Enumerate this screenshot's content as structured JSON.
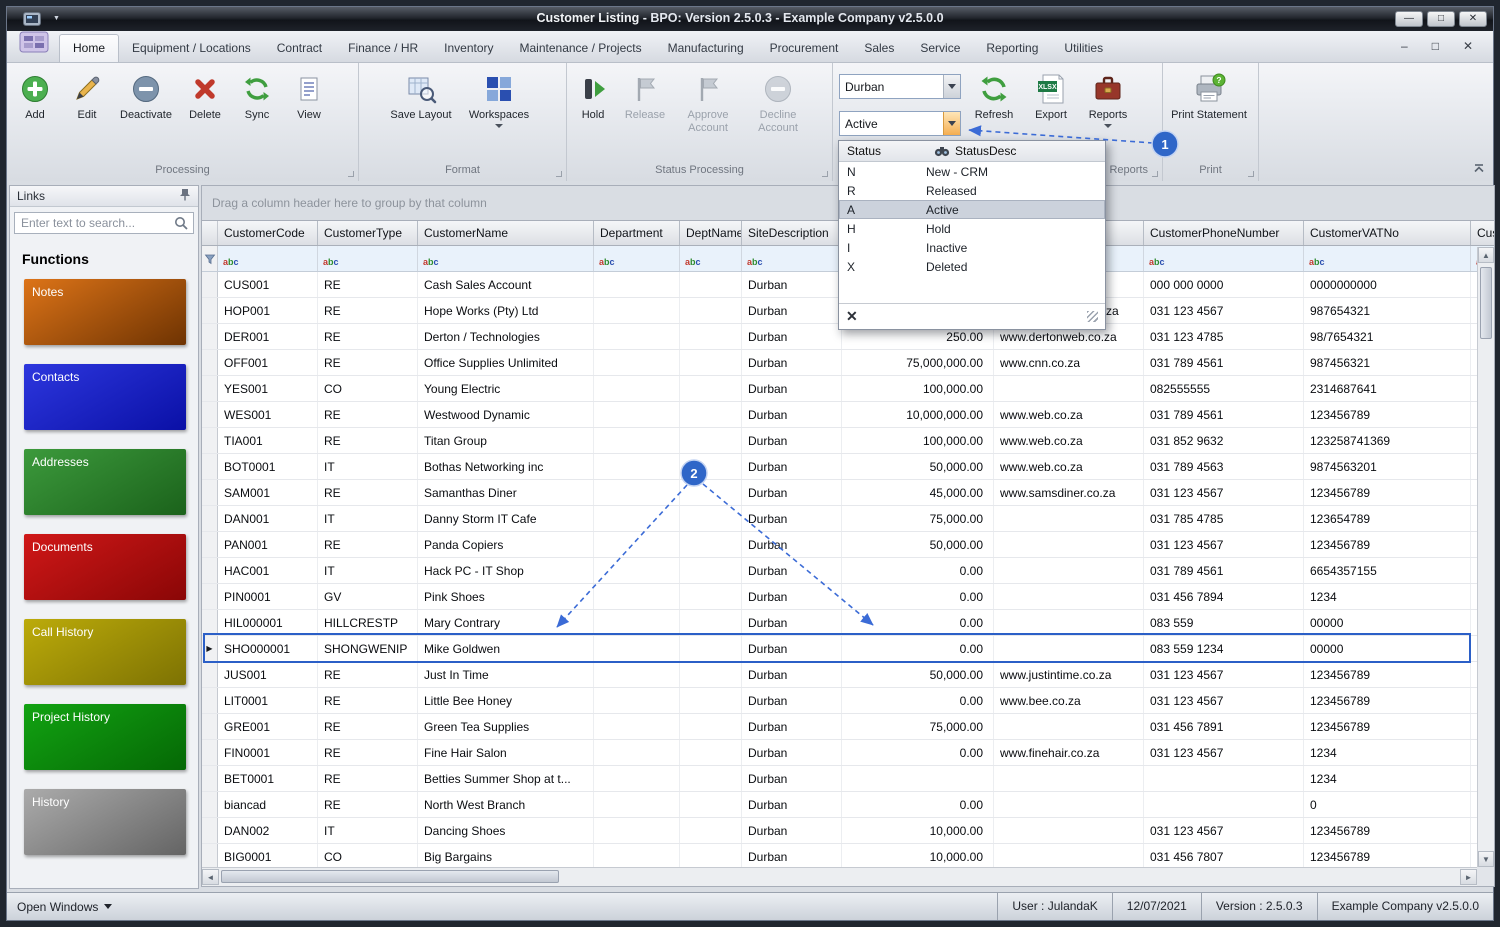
{
  "window": {
    "title_main": "Customer Listing",
    "title_rest": " - BPO: Version 2.5.0.3 - Example Company v2.5.0.0"
  },
  "tabs": [
    "Home",
    "Equipment / Locations",
    "Contract",
    "Finance / HR",
    "Inventory",
    "Maintenance / Projects",
    "Manufacturing",
    "Procurement",
    "Sales",
    "Service",
    "Reporting",
    "Utilities"
  ],
  "active_tab": "Home",
  "ribbon": {
    "groups": {
      "processing": "Processing",
      "format": "Format",
      "status_processing": "Status Processing",
      "reports": "Reports",
      "print": "Print"
    },
    "buttons": {
      "add": "Add",
      "edit": "Edit",
      "deactivate": "Deactivate",
      "delete": "Delete",
      "sync": "Sync",
      "view": "View",
      "save_layout": "Save Layout",
      "workspaces": "Workspaces",
      "hold": "Hold",
      "release": "Release",
      "approve": "Approve Account",
      "decline": "Decline Account",
      "refresh": "Refresh",
      "export": "Export",
      "reports": "Reports",
      "print_statement": "Print Statement"
    },
    "site_combo": "Durban",
    "status_combo": "Active"
  },
  "status_dropdown": {
    "col_status": "Status",
    "col_desc": "StatusDesc",
    "options": [
      {
        "code": "N",
        "desc": "New - CRM"
      },
      {
        "code": "R",
        "desc": "Released"
      },
      {
        "code": "A",
        "desc": "Active",
        "selected": true
      },
      {
        "code": "H",
        "desc": "Hold"
      },
      {
        "code": "I",
        "desc": "Inactive"
      },
      {
        "code": "X",
        "desc": "Deleted"
      }
    ]
  },
  "sidebar": {
    "title": "Links",
    "search_placeholder": "Enter text to search...",
    "section_title": "Functions",
    "tiles": [
      {
        "label": "Notes",
        "c1": "#dd7418",
        "c2": "#6e3302"
      },
      {
        "label": "Contacts",
        "c1": "#2d37de",
        "c2": "#0a10a6"
      },
      {
        "label": "Addresses",
        "c1": "#3c9a3c",
        "c2": "#1b621b"
      },
      {
        "label": "Documents",
        "c1": "#d01818",
        "c2": "#8a0606"
      },
      {
        "label": "Call History",
        "c1": "#bcab0a",
        "c2": "#7d7203"
      },
      {
        "label": "Project History",
        "c1": "#12a312",
        "c2": "#056805"
      },
      {
        "label": "History",
        "c1": "#ababab",
        "c2": "#646464"
      }
    ]
  },
  "grid": {
    "group_hint": "Drag a column header here to group by that column",
    "columns": [
      "CustomerCode",
      "CustomerType",
      "CustomerName",
      "Department",
      "DeptName",
      "SiteDescription",
      "",
      "",
      "CustomerPhoneNumber",
      "CustomerVATNo",
      "Cus"
    ],
    "rows": [
      [
        "CUS001",
        "RE",
        "Cash Sales Account",
        "",
        "",
        "Durban",
        "",
        "",
        "000 000 0000",
        "0000000000",
        ""
      ],
      [
        "HOP001",
        "RE",
        "Hope Works (Pty) Ltd",
        "",
        "",
        "Durban",
        "",
        "www.hopeworks.co.za",
        "031 123 4567",
        "987654321",
        ""
      ],
      [
        "DER001",
        "RE",
        "Derton / Technologies",
        "",
        "",
        "Durban",
        "250.00",
        "www.dertonweb.co.za",
        "031 123 4785",
        "98/7654321",
        ""
      ],
      [
        "OFF001",
        "RE",
        "Office Supplies Unlimited",
        "",
        "",
        "Durban",
        "75,000,000.00",
        "www.cnn.co.za",
        "031 789 4561",
        "987456321",
        ""
      ],
      [
        "YES001",
        "CO",
        "Young Electric",
        "",
        "",
        "Durban",
        "100,000.00",
        "",
        "082555555",
        "2314687641",
        ""
      ],
      [
        "WES001",
        "RE",
        "Westwood Dynamic",
        "",
        "",
        "Durban",
        "10,000,000.00",
        "www.web.co.za",
        "031 789 4561",
        "123456789",
        ""
      ],
      [
        "TIA001",
        "RE",
        "Titan Group",
        "",
        "",
        "Durban",
        "100,000.00",
        "www.web.co.za",
        "031 852 9632",
        "123258741369",
        ""
      ],
      [
        "BOT0001",
        "IT",
        "Bothas Networking inc",
        "",
        "",
        "Durban",
        "50,000.00",
        "www.web.co.za",
        "031 789 4563",
        "9874563201",
        ""
      ],
      [
        "SAM001",
        "RE",
        "Samanthas Diner",
        "",
        "",
        "Durban",
        "45,000.00",
        "www.samsdiner.co.za",
        "031 123 4567",
        "123456789",
        ""
      ],
      [
        "DAN001",
        "IT",
        "Danny Storm IT Cafe",
        "",
        "",
        "Durban",
        "75,000.00",
        "",
        "031 785 4785",
        "123654789",
        ""
      ],
      [
        "PAN001",
        "RE",
        "Panda Copiers",
        "",
        "",
        "Durban",
        "50,000.00",
        "",
        "031 123 4567",
        "123456789",
        ""
      ],
      [
        "HAC001",
        "IT",
        "Hack PC - IT Shop",
        "",
        "",
        "Durban",
        "0.00",
        "",
        "031 789 4561",
        "6654357155",
        ""
      ],
      [
        "PIN0001",
        "GV",
        "Pink Shoes",
        "",
        "",
        "Durban",
        "0.00",
        "",
        "031 456 7894",
        "1234",
        ""
      ],
      [
        "HIL000001",
        "HILLCRESTP",
        "Mary Contrary",
        "",
        "",
        "Durban",
        "0.00",
        "",
        "083 559",
        "00000",
        ""
      ],
      [
        "SHO000001",
        "SHONGWENIP",
        "Mike Goldwen",
        "",
        "",
        "Durban",
        "0.00",
        "",
        "083 559 1234",
        "00000",
        ""
      ],
      [
        "JUS001",
        "RE",
        "Just In Time",
        "",
        "",
        "Durban",
        "50,000.00",
        "www.justintime.co.za",
        "031 123 4567",
        "123456789",
        ""
      ],
      [
        "LIT0001",
        "RE",
        "Little Bee Honey",
        "",
        "",
        "Durban",
        "0.00",
        "www.bee.co.za",
        "031 123 4567",
        "123456789",
        ""
      ],
      [
        "GRE001",
        "RE",
        "Green Tea Supplies",
        "",
        "",
        "Durban",
        "75,000.00",
        "",
        "031 456 7891",
        "123456789",
        ""
      ],
      [
        "FIN0001",
        "RE",
        "Fine Hair Salon",
        "",
        "",
        "Durban",
        "0.00",
        "www.finehair.co.za",
        "031 123 4567",
        "1234",
        ""
      ],
      [
        "BET0001",
        "RE",
        "Betties Summer Shop at t...",
        "",
        "",
        "Durban",
        "",
        "",
        "",
        "1234",
        ""
      ],
      [
        "biancad",
        "RE",
        "North West Branch",
        "",
        "",
        "Durban",
        "0.00",
        "",
        "",
        "0",
        ""
      ],
      [
        "DAN002",
        "IT",
        "Dancing Shoes",
        "",
        "",
        "Durban",
        "10,000.00",
        "",
        "031 123 4567",
        "123456789",
        ""
      ],
      [
        "BIG0001",
        "CO",
        "Big Bargains",
        "",
        "",
        "Durban",
        "10,000.00",
        "",
        "031 456 7807",
        "123456789",
        ""
      ]
    ],
    "selected_row_index": 14
  },
  "statusbar": {
    "open_windows": "Open Windows",
    "user": "User : JulandaK",
    "date": "12/07/2021",
    "version": "Version : 2.5.0.3",
    "company": "Example Company v2.5.0.0"
  },
  "annotations": {
    "badge1": "1",
    "badge2": "2"
  },
  "icons": {
    "filter_abc": "abc",
    "xlsx_label": "XLSX",
    "print_badge": "?",
    "selected_row_arrow": "▶"
  },
  "colors": {
    "accent": "#2f66c8",
    "selection_border": "#2b5fc7"
  }
}
